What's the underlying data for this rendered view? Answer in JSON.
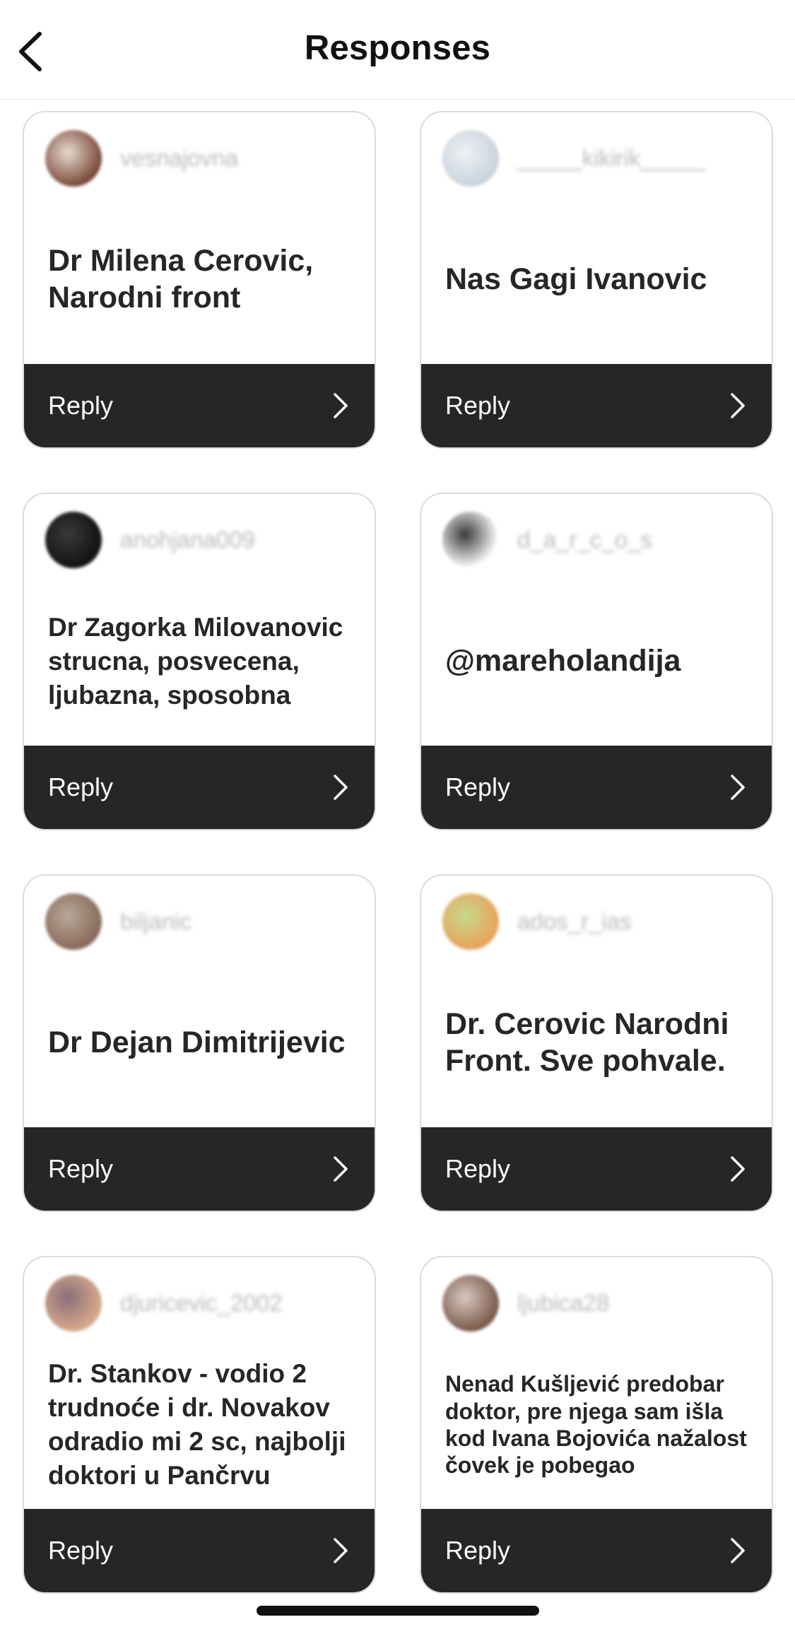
{
  "header": {
    "title": "Responses",
    "back_icon": "chevron-left-icon"
  },
  "responses": [
    {
      "username": "vesnajovna",
      "avatar_colors": [
        "#7a4a3a",
        "#e8dad0"
      ],
      "text": "Dr Milena Cerovic, Narodni front",
      "size": "l",
      "reply_label": "Reply"
    },
    {
      "username": "_____kikirik_____",
      "avatar_colors": [
        "#c9d2dc",
        "#eef1f4"
      ],
      "text": "Nas Gagi Ivanovic",
      "size": "l",
      "reply_label": "Reply"
    },
    {
      "username": "anohjana009",
      "avatar_colors": [
        "#121212",
        "#3a3a3a"
      ],
      "text": "Dr Zagorka Milovanovic strucna, posvecena, ljubazna, sposobna",
      "size": "m",
      "reply_label": "Reply"
    },
    {
      "username": "d_a_r_c_o_s",
      "avatar_colors": [
        "#ffffff",
        "#3a3a3a"
      ],
      "text": "@mareholandija",
      "size": "l",
      "reply_label": "Reply"
    },
    {
      "username": "biljanic",
      "avatar_colors": [
        "#8a6a5a",
        "#b8a898"
      ],
      "text": "Dr Dejan Dimitrijevic",
      "size": "l",
      "reply_label": "Reply"
    },
    {
      "username": "ados_r_ias",
      "avatar_colors": [
        "#e9a35a",
        "#c5d98c"
      ],
      "text": "Dr. Cerovic Narodni Front. Sve pohvale.",
      "size": "l",
      "reply_label": "Reply"
    },
    {
      "username": "djuricevic_2002",
      "avatar_colors": [
        "#d6a98a",
        "#8a6e7a"
      ],
      "text": "Dr. Stankov - vodio 2 trudnoće i dr. Novakov odradio mi 2 sc, najbolji doktori u Pančrvu",
      "size": "m",
      "reply_label": "Reply"
    },
    {
      "username": "ljubica28",
      "avatar_colors": [
        "#7a5a4a",
        "#d8c8c0"
      ],
      "text": "Nenad Kušljević predobar doktor, pre njega sam išla kod Ivana Bojovića nažalost čovek je pobegao",
      "size": "s",
      "reply_label": "Reply"
    }
  ],
  "icons": {
    "reply_chevron": "chevron-right-icon"
  }
}
